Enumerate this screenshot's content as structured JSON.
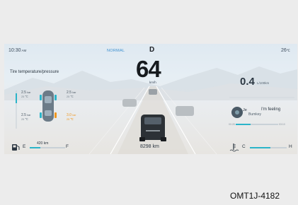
{
  "status": {
    "time": "10:30",
    "ampm": "AM",
    "drive_mode": "NORMAL",
    "gear": "D",
    "outside_temp": "26",
    "outside_temp_unit": "℃"
  },
  "speedometer": {
    "speed": "64",
    "unit": "km/h"
  },
  "tires": {
    "title": "Tire temperature/pressure",
    "front_left": {
      "pressure": "2.5",
      "unit": "bar",
      "temp": "25 ℃"
    },
    "front_right": {
      "pressure": "2.5",
      "unit": "bar",
      "temp": "25 ℃"
    },
    "rear_left": {
      "pressure": "2.5",
      "unit": "bar",
      "temp": "25 ℃"
    },
    "rear_right": {
      "pressure": "3.0",
      "unit": "bar",
      "temp": "25 ℃",
      "warning": true
    }
  },
  "trip": {
    "value": "0.4",
    "unit": "L/100km"
  },
  "media": {
    "title_prefix": "Je",
    "title": "I'm feeling",
    "artist": "Bumkey",
    "time_start": "00:28",
    "time_end": "03:10",
    "progress": 0.35
  },
  "odometer": {
    "value": "8298 km"
  },
  "fuel": {
    "range": "420 km",
    "empty_label": "E",
    "full_label": "F",
    "level": 0.3,
    "icon": "fuel-pump-icon"
  },
  "coolant": {
    "cold_label": "C",
    "hot_label": "H",
    "level": 0.55,
    "icon": "coolant-temp-icon"
  },
  "caption": "OMT1J-4182",
  "colors": {
    "accent": "#2bb4c9",
    "mode": "#3a8fd0",
    "warning": "#f0961e"
  }
}
